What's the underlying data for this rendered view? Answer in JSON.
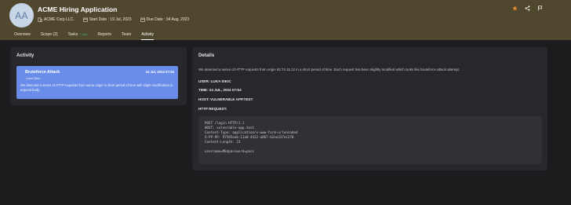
{
  "header": {
    "avatar_initials": "AA",
    "title": "ACME Hiring Application",
    "company": "ACME Corp LLC.",
    "start_date": "Start Date : 19 Jul, 2023",
    "due_date": "Due Date : 04 Aug, 2023",
    "actions": [
      "star-icon",
      "share-icon",
      "flag-icon"
    ],
    "star_color": "#e58a2f"
  },
  "tabs": [
    {
      "label": "Overview",
      "badge": "",
      "active": false
    },
    {
      "label": "Scope (2)",
      "badge": "",
      "active": false
    },
    {
      "label": "Tasks",
      "badge": "1 task",
      "active": false
    },
    {
      "label": "Reports",
      "badge": "",
      "active": false
    },
    {
      "label": "Team",
      "badge": "",
      "active": false
    },
    {
      "label": "Activity",
      "badge": "",
      "active": true
    }
  ],
  "activity": {
    "panel_title": "Activity",
    "items": [
      {
        "title": "Bruteforce Attack",
        "date": "24 Jul, 2024 07:53",
        "user": "Luka Sikic",
        "description": "We detected a series of HTTP requests from same origin in short period of time with slight modification in request body."
      }
    ]
  },
  "details": {
    "panel_title": "Details",
    "intro": "We detected a series of HTTP requests from origin 92.74.15.12 in a short period of time. Each request has been slightly modified which looks like bruteforce attack attempt.",
    "user": "USER: LUKA SIKIC",
    "time": "TIME: 24 JUL, 2024 07:53",
    "host": "HOST: VULNERABLE APP.TEST",
    "request_label": "HTTP REQUEST:",
    "request_lines": [
      "POST /login HTTP/1.1",
      "HOST: vulnerable-app.test",
      "Content-Type: application/x-www-form-urlencoded",
      "X-PP-PP: 97585eab-11a0-4422-a867-b2ea337ec270",
      "Content-Length: 23",
      "",
      "username=ME$password=pass"
    ]
  },
  "colors": {
    "header_bg": "#50482e",
    "activity_card_bg": "#6a8de9",
    "tab_badge": "#3fa56e"
  }
}
